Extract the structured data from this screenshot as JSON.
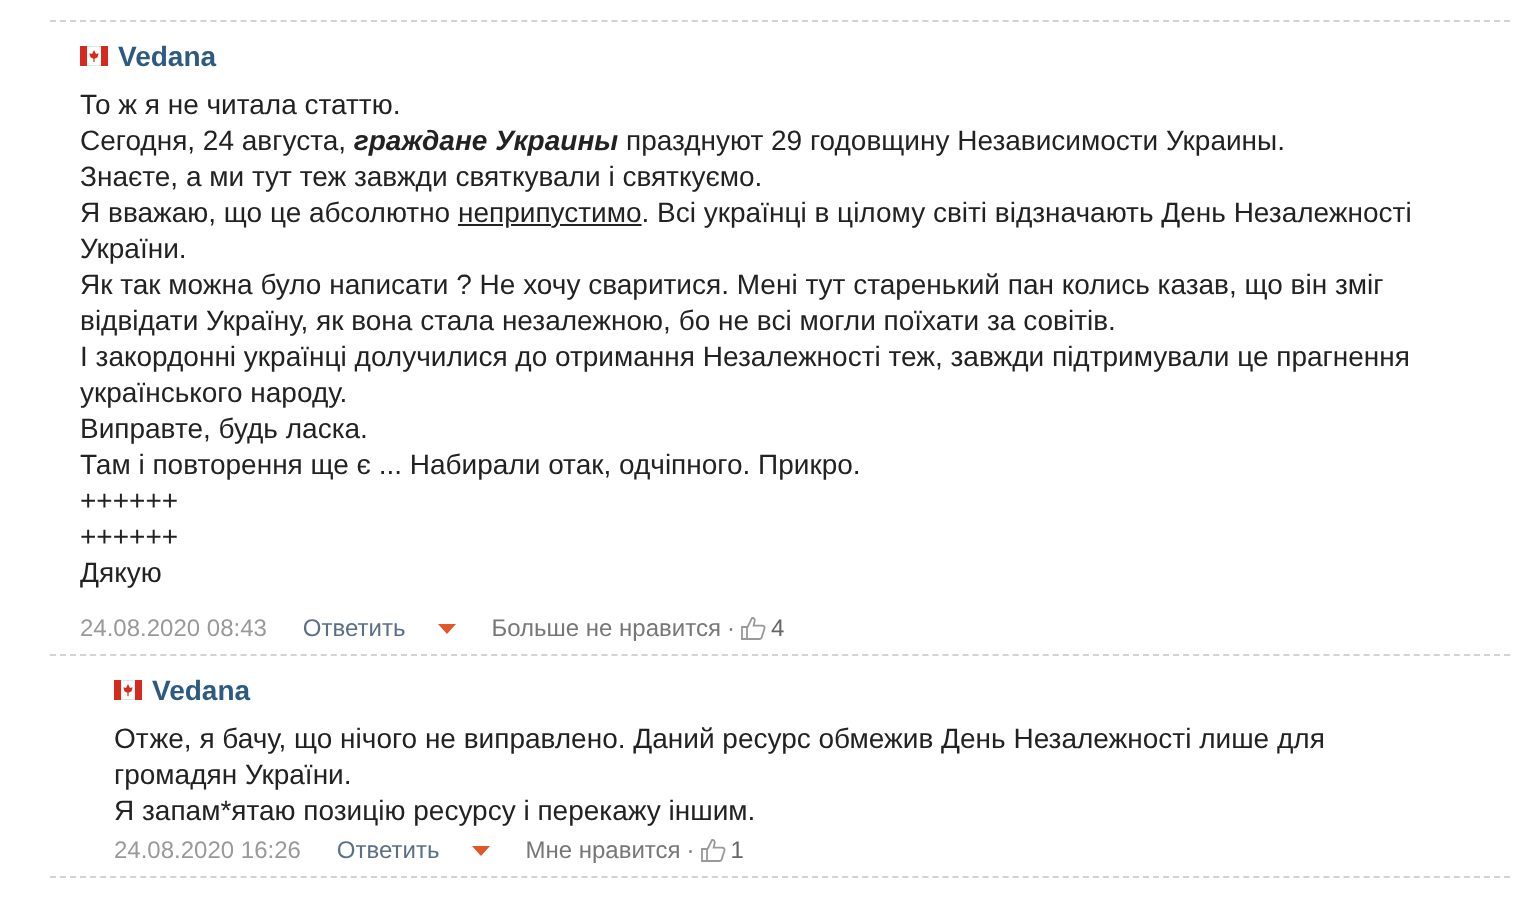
{
  "comments": [
    {
      "author": "Vedana",
      "reply": false,
      "paragraphs": [
        [
          {
            "text": "То ж я не читала статтю.",
            "kind": "plain"
          }
        ],
        [
          {
            "text": "Сегодня, 24 августа, ",
            "kind": "plain"
          },
          {
            "text": "граждане Украины",
            "kind": "emphasis"
          },
          {
            "text": " празднуют 29 годовщину Независимости Украины.",
            "kind": "plain"
          }
        ],
        [
          {
            "text": "Знаєте, а ми тут теж завжди святкували і святкуємо.",
            "kind": "plain"
          }
        ],
        [
          {
            "text": "Я вважаю, що це абсолютно ",
            "kind": "plain"
          },
          {
            "text": "неприпустимо",
            "kind": "underlined"
          },
          {
            "text": ". Всі українці в цілому світі відзначають День Незалежності України.",
            "kind": "plain"
          }
        ],
        [
          {
            "text": "Як так можна було написати ? Не хочу сваритися. Мені тут старенький пан колись казав, що він зміг відвідати Україну, як вона стала незалежною, бо не всі могли поїхати за совітів.",
            "kind": "plain"
          }
        ],
        [
          {
            "text": "І закордонні українці долучилися до отримання Незалежності теж, завжди підтримували це прагнення українського народу.",
            "kind": "plain"
          }
        ],
        [
          {
            "text": "Виправте, будь ласка.",
            "kind": "plain"
          }
        ],
        [
          {
            "text": "Там і повторення ще є ... Набирали отак, одчіпного. Прикро.",
            "kind": "plain"
          }
        ],
        [
          {
            "text": "++++++",
            "kind": "plain"
          }
        ],
        [
          {
            "text": "++++++",
            "kind": "plain"
          }
        ],
        [
          {
            "text": "Дякую",
            "kind": "plain"
          }
        ]
      ],
      "date": "24.08.2020 08:43",
      "reply_label": "Ответить",
      "like_label": "Больше не нравится",
      "separator": "·",
      "likes": "4"
    },
    {
      "author": "Vedana",
      "reply": true,
      "paragraphs": [
        [
          {
            "text": "Отже, я бачу, що нічого не виправлено. Даний ресурс обмежив День Незалежності лише для громадян України.",
            "kind": "plain"
          }
        ],
        [
          {
            "text": "Я запам*ятаю позицію ресурсу і перекажу іншим.",
            "kind": "plain"
          }
        ]
      ],
      "date": "24.08.2020 16:26",
      "reply_label": "Ответить",
      "like_label": "Мне нравится",
      "separator": "·",
      "likes": "1"
    }
  ]
}
